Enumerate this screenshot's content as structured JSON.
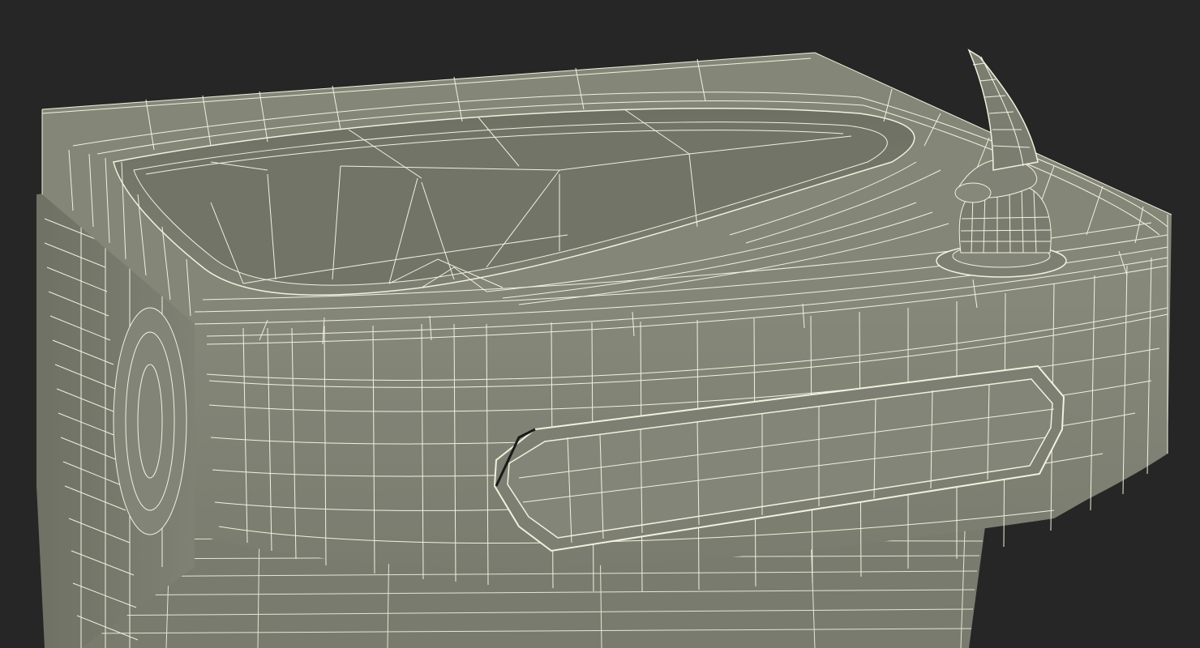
{
  "scene": {
    "subject": "drinking-fountain-wireframe",
    "colors": {
      "background": "#262626",
      "surface": "#808274",
      "surface_dark": "#6d6f62",
      "surface_light": "#8c8e80",
      "basin": "#74766a",
      "wire": "#f2f1df"
    }
  }
}
